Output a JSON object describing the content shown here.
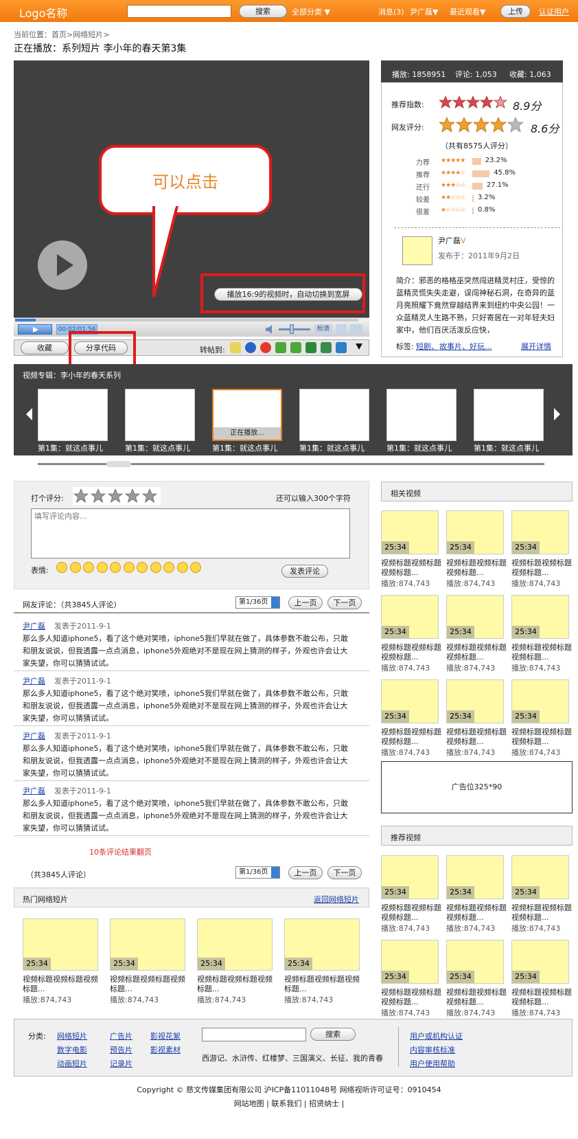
{
  "header": {
    "logo": "Logo名称",
    "search_button": "搜索",
    "all_categories": "全部分类",
    "messages": "消息(3)",
    "user": "尹广磊",
    "recent": "最近观看",
    "upload": "上传",
    "certify": "认证用户"
  },
  "breadcrumb": "当前位置：首页>网络短片>",
  "now_playing": "正在播放：系列短片 李小年的春天第3集",
  "player": {
    "callout": "可以点击",
    "wide_toggle": "播放16:9的视频时，自动切换到宽屏",
    "time": "00:02/01:56",
    "normal_label": "标清",
    "progress_fraction": 0.06
  },
  "actions": {
    "favorite": "收藏",
    "share_code": "分享代码",
    "repost_label": "转帖到:"
  },
  "stats": {
    "plays": "播放: 1858951",
    "comments": "评论: 1,053",
    "favorites": "收藏: 1,063",
    "recommend_label": "推荐指数:",
    "recommend_score": "8.9分",
    "fan_label": "网友评分:",
    "fan_score": "8.6分",
    "rating_count": "（共有8575人评分）",
    "distribution": [
      {
        "label": "力荐",
        "stars": "★★★★★",
        "pct": "23.2%",
        "value": 23.2
      },
      {
        "label": "推荐",
        "stars": "★★★★☆",
        "pct": "45.8%",
        "value": 45.8
      },
      {
        "label": "还行",
        "stars": "★★★☆☆",
        "pct": "27.1%",
        "value": 27.1
      },
      {
        "label": "较差",
        "stars": "★★☆☆☆",
        "pct": "3.2%",
        "value": 3.2
      },
      {
        "label": "很差",
        "stars": "★☆☆☆☆",
        "pct": "0.8%",
        "value": 0.8
      }
    ],
    "author": "尹广磊",
    "publish_date": "发布于：2011年9月2日",
    "summary": "简介：邪恶的格格巫突然闯进精灵村庄，受惊的蓝精灵慌失失走避，误闯神秘石洞，在奇异的蓝月亮照耀下竟然穿越结界来到纽约中央公园！一众蓝精灵人生路不熟，只好寄居在一对年轻夫妇家中，他们百厌活泼反应快，",
    "tags_label": "标签:",
    "tags": [
      "短剧、",
      "故事片、",
      "好玩..."
    ],
    "expand": "展开详情"
  },
  "album": {
    "title": "视频专辑：李小年的春天系列",
    "playing": "正在播放...",
    "episodes": [
      "第1集：就这点事儿",
      "第1集：就这点事儿",
      "第1集：就这点事儿",
      "第1集：就这点事儿",
      "第1集：就这点事儿",
      "第1集：就这点事儿"
    ]
  },
  "comment_form": {
    "rate_label": "打个评分:",
    "char_hint": "还可以输入300个字符",
    "placeholder": "填写评论内容...",
    "emoji_label": "表情:",
    "submit": "发表评论"
  },
  "comments": {
    "header": "网友评论：（共3845人评论）",
    "page": "第1/36页",
    "prev": "上一页",
    "next": "下一页",
    "items": [
      {
        "user": "尹广磊",
        "date": "发表于2011-9-1",
        "body": "那么多人知道iphone5，看了这个绝对笑喷，iphone5我们早就在做了，具体参数不敢公布，只敢和朋友说说，但我透露一点点消息，iphone5外观绝对不是现在网上猜测的样子，外观也许会让大家失望，你可以猜猜试试。"
      },
      {
        "user": "尹广磊",
        "date": "发表于2011-9-1",
        "body": "那么多人知道iphone5，看了这个绝对笑喷，iphone5我们早就在做了，具体参数不敢公布，只敢和朋友说说，但我透露一点点消息，iphone5外观绝对不是现在网上猜测的样子，外观也许会让大家失望，你可以猜猜试试。"
      },
      {
        "user": "尹广磊",
        "date": "发表于2011-9-1",
        "body": "那么多人知道iphone5，看了这个绝对笑喷，iphone5我们早就在做了，具体参数不敢公布，只敢和朋友说说，但我透露一点点消息，iphone5外观绝对不是现在网上猜测的样子，外观也许会让大家失望，你可以猜猜试试。"
      },
      {
        "user": "尹广磊",
        "date": "发表于2011-9-1",
        "body": "那么多人知道iphone5，看了这个绝对笑喷，iphone5我们早就在做了，具体参数不敢公布，只敢和朋友说说，但我透露一点点消息，iphone5外观绝对不是现在网上猜测的样子，外观也许会让大家失望，你可以猜猜试试。"
      }
    ],
    "pagination_note": "10条评论结果翻页",
    "total_bottom": "（共3845人评论）"
  },
  "hot": {
    "title": "热门网络短片",
    "back": "返回网络短片",
    "items": [
      {
        "duration": "25:34",
        "title": "视频标题视频标题视频标题...",
        "plays": "播放:874,743"
      },
      {
        "duration": "25:34",
        "title": "视频标题视频标题视频标题...",
        "plays": "播放:874,743"
      },
      {
        "duration": "25:34",
        "title": "视频标题视频标题视频标题...",
        "plays": "播放:874,743"
      },
      {
        "duration": "25:34",
        "title": "视频标题视频标题视频标题...",
        "plays": "播放:874,743"
      }
    ]
  },
  "related": {
    "title": "相关视频",
    "item": {
      "duration": "25:34",
      "title": "视频标题视频标题视频标题...",
      "plays": "播放:874,743"
    }
  },
  "ad": "广告位325*90",
  "recommended": {
    "title": "推荐视频"
  },
  "footer": {
    "category_label": "分类:",
    "cats": [
      "网络短片",
      "广告片",
      "影视花絮",
      "数字电影",
      "预告片",
      "影视素材",
      "动画短片",
      "记录片"
    ],
    "search_button": "搜索",
    "hot_keywords": "西游记、水浒传、红楼梦、三国演义、长征、我的青春",
    "links": [
      "用户或机构认证",
      "内容审核标准",
      "用户使用帮助"
    ],
    "copyright": "Copyright © 慈文传媒集团有限公司   沪ICP备11011048号 网络视听许可证号：0910454",
    "bottom_links": "网站地图    |    联系我们    |    招贤纳士    |"
  },
  "colors": {
    "accent": "#f27a0e",
    "player_bg": "#404040",
    "annotation": "#e01b1b",
    "thumb_fill": "#fffaa8"
  }
}
